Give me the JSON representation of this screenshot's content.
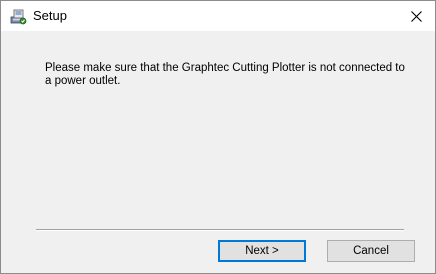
{
  "window": {
    "title": "Setup",
    "icon": "setup-installer-icon",
    "close_icon": "close-icon"
  },
  "content": {
    "message": "Please make sure that the Graphtec Cutting Plotter is not connected to a power outlet."
  },
  "buttons": {
    "next_label": "Next >",
    "cancel_label": "Cancel"
  },
  "colors": {
    "accent": "#0078d7",
    "dialog_background": "#f0f0f0",
    "titlebar_background": "#ffffff"
  }
}
